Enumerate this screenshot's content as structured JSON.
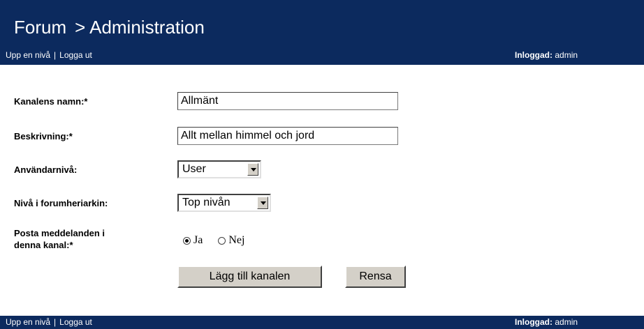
{
  "header": {
    "title_main": "Forum",
    "title_section": "> Administration"
  },
  "nav": {
    "up_link": "Upp en nivå",
    "separator": "|",
    "logout_link": "Logga ut",
    "logged_in_label": "Inloggad:",
    "logged_in_user": "admin"
  },
  "form": {
    "channel_name_label": "Kanalens namn:*",
    "channel_name_value": "Allmänt",
    "description_label": "Beskrivning:*",
    "description_value": "Allt mellan himmel och jord",
    "user_level_label": "Användarnivå:",
    "user_level_value": "User",
    "forum_level_label": "Nivå i forumheriarkin:",
    "forum_level_value": "Top nivån",
    "post_label_line1": "Posta meddelanden i",
    "post_label_line2": "denna kanal:*",
    "radio_yes": "Ja",
    "radio_no": "Nej",
    "radio_selected": "Ja",
    "submit_button": "Lägg till kanalen",
    "reset_button": "Rensa"
  },
  "colors": {
    "header_bg": "#0c2a5e",
    "button_bg": "#d4d0c8"
  }
}
